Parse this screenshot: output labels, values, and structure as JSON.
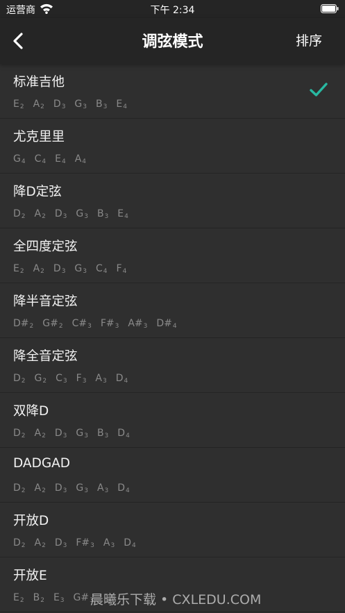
{
  "status_bar": {
    "carrier": "运营商",
    "time": "下午 2:34"
  },
  "nav": {
    "title": "调弦模式",
    "sort_label": "排序",
    "back_icon": "chevron-left-icon"
  },
  "colors": {
    "accent_check": "#28b9a2",
    "background": "#2f2f2f",
    "bar": "#252525"
  },
  "tunings": [
    {
      "name": "标准吉他",
      "selected": true,
      "notes": [
        {
          "n": "E",
          "o": "2"
        },
        {
          "n": "A",
          "o": "2"
        },
        {
          "n": "D",
          "o": "3"
        },
        {
          "n": "G",
          "o": "3"
        },
        {
          "n": "B",
          "o": "3"
        },
        {
          "n": "E",
          "o": "4"
        }
      ]
    },
    {
      "name": "尤克里里",
      "notes": [
        {
          "n": "G",
          "o": "4"
        },
        {
          "n": "C",
          "o": "4"
        },
        {
          "n": "E",
          "o": "4"
        },
        {
          "n": "A",
          "o": "4"
        }
      ]
    },
    {
      "name": "降D定弦",
      "notes": [
        {
          "n": "D",
          "o": "2"
        },
        {
          "n": "A",
          "o": "2"
        },
        {
          "n": "D",
          "o": "3"
        },
        {
          "n": "G",
          "o": "3"
        },
        {
          "n": "B",
          "o": "3"
        },
        {
          "n": "E",
          "o": "4"
        }
      ]
    },
    {
      "name": "全四度定弦",
      "notes": [
        {
          "n": "E",
          "o": "2"
        },
        {
          "n": "A",
          "o": "2"
        },
        {
          "n": "D",
          "o": "3"
        },
        {
          "n": "G",
          "o": "3"
        },
        {
          "n": "C",
          "o": "4"
        },
        {
          "n": "F",
          "o": "4"
        }
      ]
    },
    {
      "name": "降半音定弦",
      "notes": [
        {
          "n": "D#",
          "o": "2"
        },
        {
          "n": "G#",
          "o": "2"
        },
        {
          "n": "C#",
          "o": "3"
        },
        {
          "n": "F#",
          "o": "3"
        },
        {
          "n": "A#",
          "o": "3"
        },
        {
          "n": "D#",
          "o": "4"
        }
      ]
    },
    {
      "name": "降全音定弦",
      "notes": [
        {
          "n": "D",
          "o": "2"
        },
        {
          "n": "G",
          "o": "2"
        },
        {
          "n": "C",
          "o": "3"
        },
        {
          "n": "F",
          "o": "3"
        },
        {
          "n": "A",
          "o": "3"
        },
        {
          "n": "D",
          "o": "4"
        }
      ]
    },
    {
      "name": "双降D",
      "notes": [
        {
          "n": "D",
          "o": "2"
        },
        {
          "n": "A",
          "o": "2"
        },
        {
          "n": "D",
          "o": "3"
        },
        {
          "n": "G",
          "o": "3"
        },
        {
          "n": "B",
          "o": "3"
        },
        {
          "n": "D",
          "o": "4"
        }
      ]
    },
    {
      "name": "DADGAD",
      "notes": [
        {
          "n": "D",
          "o": "2"
        },
        {
          "n": "A",
          "o": "2"
        },
        {
          "n": "D",
          "o": "3"
        },
        {
          "n": "G",
          "o": "3"
        },
        {
          "n": "A",
          "o": "3"
        },
        {
          "n": "D",
          "o": "4"
        }
      ]
    },
    {
      "name": "开放D",
      "notes": [
        {
          "n": "D",
          "o": "2"
        },
        {
          "n": "A",
          "o": "2"
        },
        {
          "n": "D",
          "o": "3"
        },
        {
          "n": "F#",
          "o": "3"
        },
        {
          "n": "A",
          "o": "3"
        },
        {
          "n": "D",
          "o": "4"
        }
      ]
    },
    {
      "name": "开放E",
      "notes": [
        {
          "n": "E",
          "o": "2"
        },
        {
          "n": "B",
          "o": "2"
        },
        {
          "n": "E",
          "o": "3"
        },
        {
          "n": "G#",
          "o": "3"
        }
      ]
    }
  ],
  "watermark": "晨曦乐下载 • CXLEDU.COM"
}
